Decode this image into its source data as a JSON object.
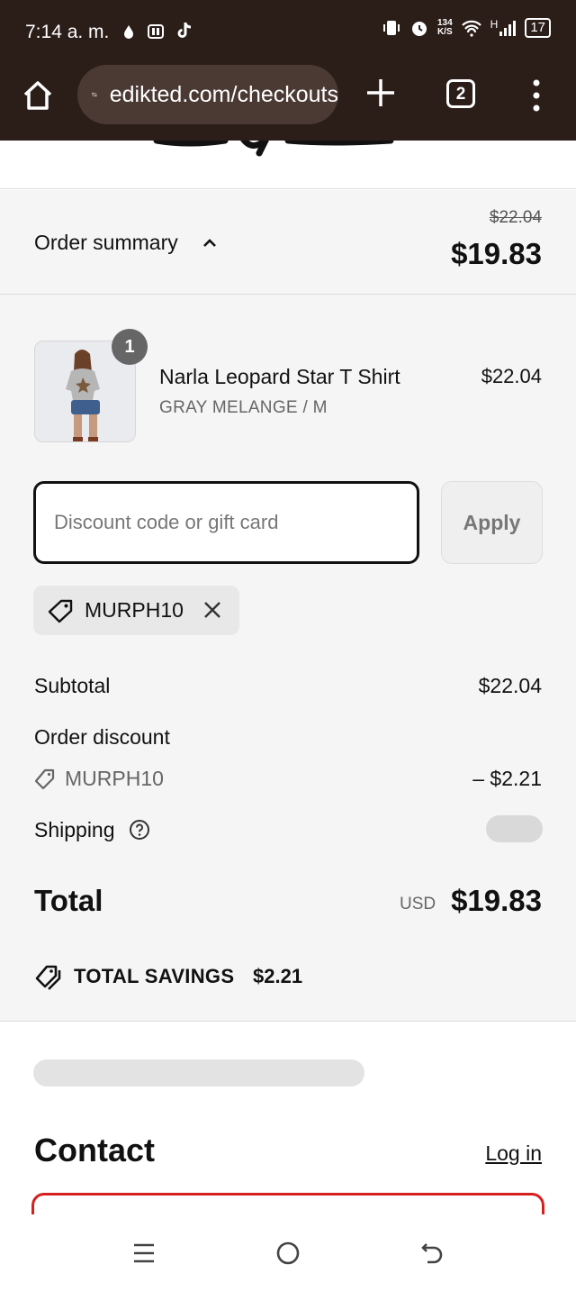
{
  "status_bar": {
    "time": "7:14 a. m.",
    "net_speed_top": "134",
    "net_speed_bottom": "K/S",
    "network": "H",
    "battery": "17"
  },
  "browser": {
    "url": "edikted.com/checkouts",
    "tab_count": "2"
  },
  "order_summary": {
    "label": "Order summary",
    "original_total": "$22.04",
    "total": "$19.83"
  },
  "product": {
    "quantity": "1",
    "name": "Narla Leopard Star T Shirt",
    "variant": "GRAY MELANGE / M",
    "price": "$22.04"
  },
  "discount": {
    "placeholder": "Discount code or gift card",
    "apply_label": "Apply",
    "applied_code": "MURPH10"
  },
  "lines": {
    "subtotal_label": "Subtotal",
    "subtotal_value": "$22.04",
    "order_discount_label": "Order discount",
    "discount_code": "MURPH10",
    "discount_value": "– $2.21",
    "shipping_label": "Shipping"
  },
  "total": {
    "label": "Total",
    "currency": "USD",
    "value": "$19.83"
  },
  "savings": {
    "label": "TOTAL SAVINGS",
    "value": "$2.21"
  },
  "contact": {
    "title": "Contact",
    "login_label": "Log in"
  },
  "colors": {
    "browser_bar": "#2b1d18",
    "summary_bg": "#f5f5f5",
    "error_border": "#d62020"
  }
}
